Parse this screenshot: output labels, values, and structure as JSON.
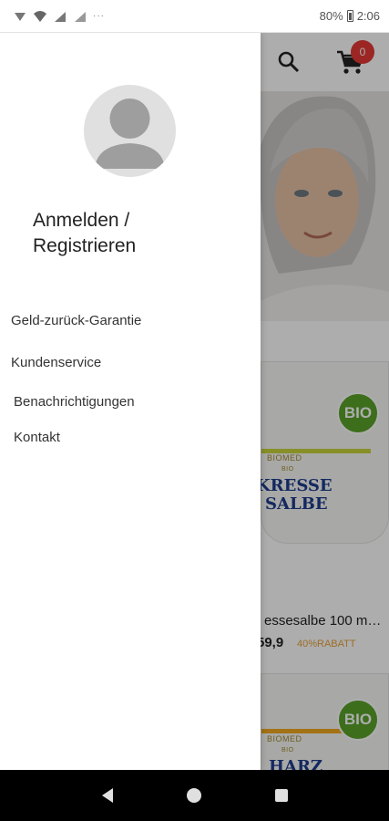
{
  "status_bar": {
    "dots": "···",
    "battery_percent": "80%",
    "time": "2:06"
  },
  "toolbar": {
    "search_icon": "search-icon",
    "cart_icon": "cart-icon",
    "cart_count": "0"
  },
  "drawer": {
    "login_line1": "Anmelden /",
    "login_line2": "Registrieren",
    "menu": [
      {
        "label": "Geld-zurück-Garantie"
      },
      {
        "label": "Kundenservice"
      },
      {
        "label": "Benachrichtigungen"
      },
      {
        "label": "Kontakt"
      }
    ]
  },
  "products": [
    {
      "badge": "BIO",
      "brand": "BIOMED",
      "sub": "BIO",
      "title_line1": "KRESSE",
      "title_line2": "SALBE",
      "name": "essesalbe 100 m…",
      "price": "59,9",
      "discount": "40%RABATT"
    },
    {
      "badge": "BIO",
      "brand": "BIOMED",
      "sub": "BIO",
      "title_line1": "HARZ"
    }
  ],
  "colors": {
    "accent_red": "#e53935",
    "bio_green": "#5aa32a",
    "discount_orange": "#e6a23c",
    "label_blue": "#1d3d8c"
  }
}
